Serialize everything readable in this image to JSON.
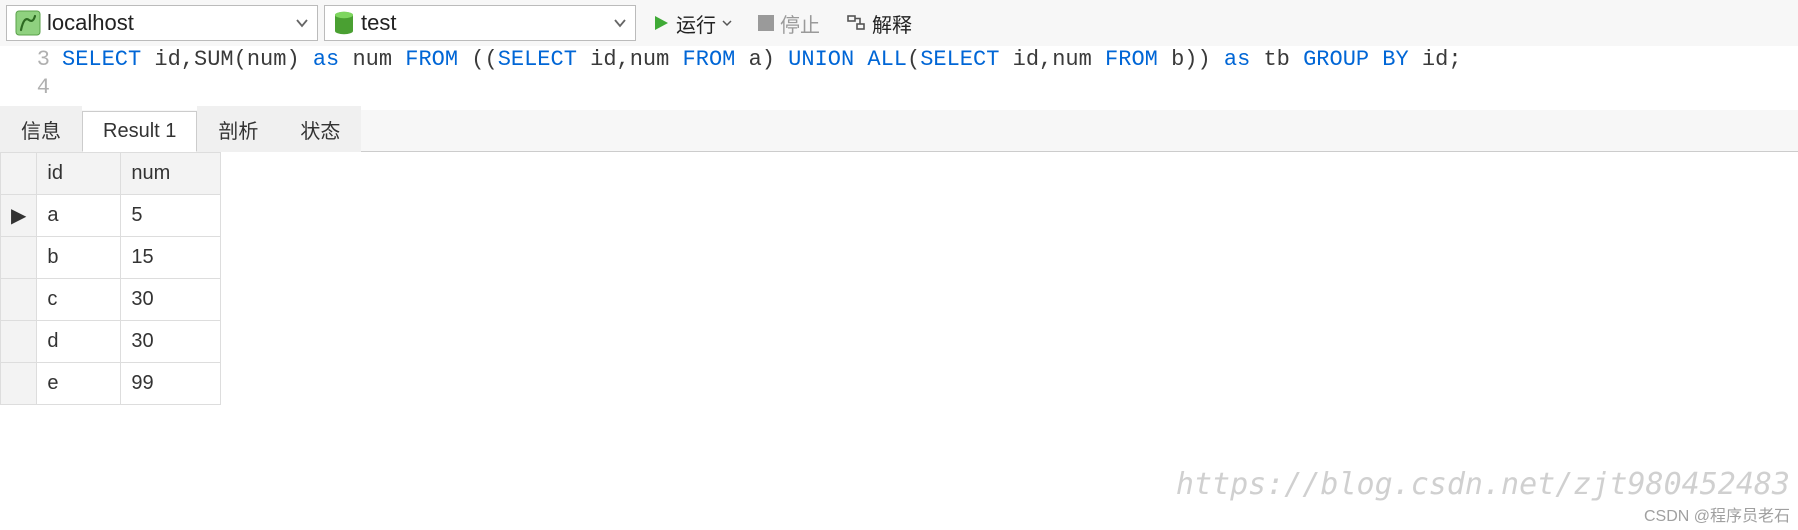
{
  "toolbar": {
    "connection": "localhost",
    "database": "test",
    "run_label": "运行",
    "stop_label": "停止",
    "explain_label": "解释"
  },
  "editor": {
    "lines": [
      {
        "num": "3",
        "tokens": [
          {
            "t": "kw",
            "v": "SELECT "
          },
          {
            "t": "plain",
            "v": "id,SUM(num) "
          },
          {
            "t": "kw",
            "v": "as "
          },
          {
            "t": "plain",
            "v": "num "
          },
          {
            "t": "kw",
            "v": "FROM "
          },
          {
            "t": "plain",
            "v": "(("
          },
          {
            "t": "kw",
            "v": "SELECT "
          },
          {
            "t": "plain",
            "v": "id,num "
          },
          {
            "t": "kw",
            "v": "FROM "
          },
          {
            "t": "plain",
            "v": "a) "
          },
          {
            "t": "kw",
            "v": "UNION ALL"
          },
          {
            "t": "plain",
            "v": "("
          },
          {
            "t": "kw",
            "v": "SELECT "
          },
          {
            "t": "plain",
            "v": "id,num "
          },
          {
            "t": "kw",
            "v": "FROM "
          },
          {
            "t": "plain",
            "v": "b)) "
          },
          {
            "t": "kw",
            "v": "as "
          },
          {
            "t": "plain",
            "v": "tb "
          },
          {
            "t": "kw",
            "v": "GROUP BY "
          },
          {
            "t": "plain",
            "v": "id;"
          }
        ]
      },
      {
        "num": "4",
        "tokens": []
      }
    ]
  },
  "tabs": {
    "items": [
      {
        "label": "信息",
        "active": false
      },
      {
        "label": "Result 1",
        "active": true
      },
      {
        "label": "剖析",
        "active": false
      },
      {
        "label": "状态",
        "active": false
      }
    ]
  },
  "result": {
    "columns": [
      "id",
      "num"
    ],
    "rows": [
      {
        "id": "a",
        "num": "5",
        "current": true
      },
      {
        "id": "b",
        "num": "15",
        "current": false
      },
      {
        "id": "c",
        "num": "30",
        "current": false
      },
      {
        "id": "d",
        "num": "30",
        "current": false
      },
      {
        "id": "e",
        "num": "99",
        "current": false
      }
    ]
  },
  "watermark": "https://blog.csdn.net/zjt980452483",
  "credit": "CSDN @程序员老石"
}
